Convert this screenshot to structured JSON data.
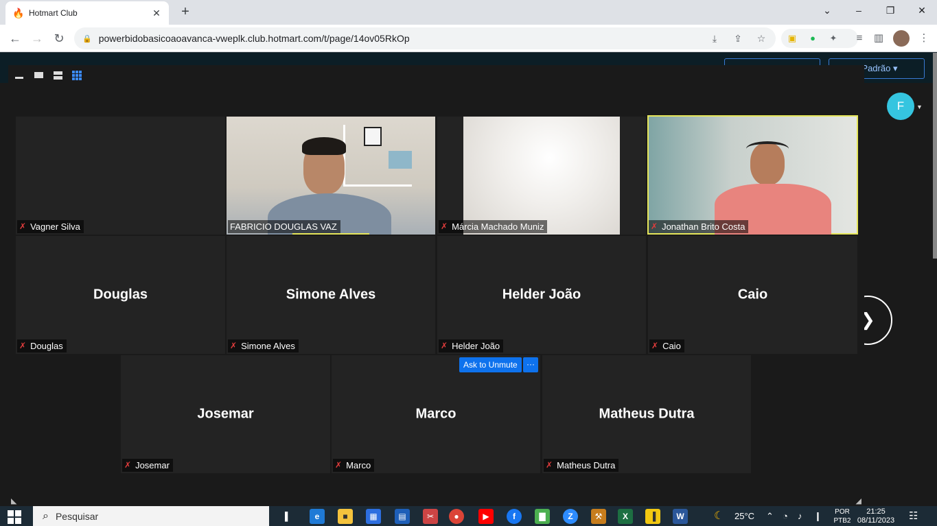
{
  "browser": {
    "tab_title": "Hotmart Club",
    "url": "powerbidobasicoaoavanca-vweplk.club.hotmart.com/t/page/14ov05RkOp"
  },
  "page": {
    "profile_initial": "F",
    "theme_button": "Tema Padrão"
  },
  "meeting": {
    "ask_to_unmute": "Ask to Unmute",
    "more_label": "···",
    "rows": [
      [
        {
          "name": "Vagner Silva",
          "big": ""
        },
        {
          "name": "FABRICIO DOUGLAS VAZ",
          "big": ""
        },
        {
          "name": "Márcia Machado Muniz",
          "big": ""
        },
        {
          "name": "Jonathan Brito Costa",
          "big": ""
        }
      ],
      [
        {
          "name": "Douglas",
          "big": "Douglas"
        },
        {
          "name": "Simone Alves",
          "big": "Simone Alves"
        },
        {
          "name": "Helder João",
          "big": "Helder João"
        },
        {
          "name": "Caio",
          "big": "Caio"
        }
      ],
      [
        {
          "name": "Josemar",
          "big": "Josemar"
        },
        {
          "name": "Marco",
          "big": "Marco"
        },
        {
          "name": "Matheus Dutra",
          "big": "Matheus Dutra"
        }
      ]
    ]
  },
  "taskbar": {
    "search_placeholder": "Pesquisar",
    "temperature": "25°C",
    "lang_top": "POR",
    "lang_bottom": "PTB2",
    "time": "21:25",
    "date": "08/11/2023"
  },
  "colors": {
    "zoom_blue": "#0e72ed",
    "active_speaker": "#e6e65a",
    "muted_red": "#e03c3c"
  }
}
